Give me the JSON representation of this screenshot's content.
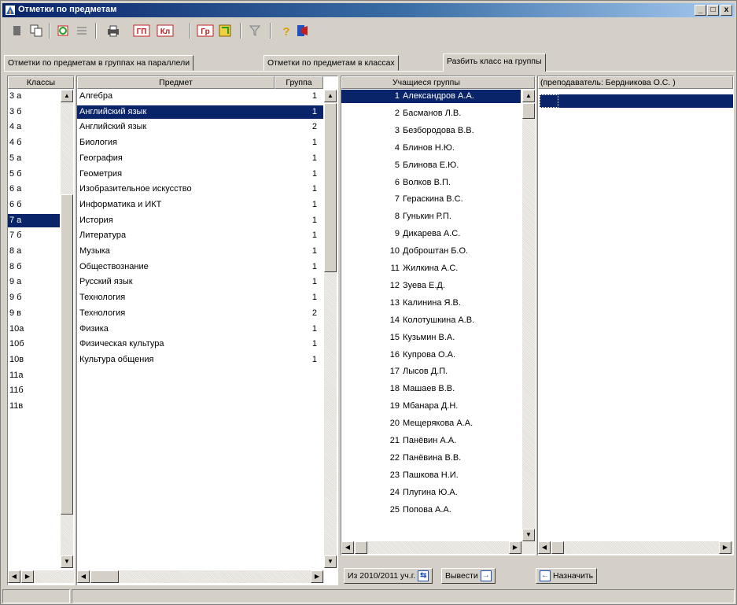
{
  "window": {
    "title": "Отметки по предметам",
    "controls": {
      "minimize": "_",
      "maximize": "□",
      "close": "x"
    }
  },
  "toolbar": {
    "icons": [
      "new-icon",
      "copy-icon",
      "refresh-icon",
      "list-icon",
      "print-icon",
      "gp-icon",
      "kl-icon",
      "gr-icon",
      "select-icon",
      "filter-icon",
      "help-icon",
      "exit-icon"
    ],
    "gp_label": "ГП",
    "kl_label": "Кл",
    "gr_label": "Гр"
  },
  "tabs": [
    {
      "label": "Отметки по предметам в группах на параллели",
      "active": false
    },
    {
      "label": "Отметки по предметам в классах",
      "active": false
    },
    {
      "label": "Разбить класс на группы",
      "active": true
    }
  ],
  "classes": {
    "header": "Классы",
    "items": [
      "3 а",
      "3 б",
      "4 а",
      "4 б",
      "5 а",
      "5 б",
      "6 а",
      "6 б",
      "7 а",
      "7 б",
      "8 а",
      "8 б",
      "9 а",
      "9 б",
      "9 в",
      "10а",
      "10б",
      "10в",
      "11а",
      "11б",
      "11в"
    ],
    "selected_index": 8
  },
  "subjects": {
    "header_subject": "Предмет",
    "header_group": "Группа",
    "rows": [
      {
        "subject": "Алгебра",
        "group": "1"
      },
      {
        "subject": "Английский язык",
        "group": "1"
      },
      {
        "subject": "Английский язык",
        "group": "2"
      },
      {
        "subject": "Биология",
        "group": "1"
      },
      {
        "subject": "География",
        "group": "1"
      },
      {
        "subject": "Геометрия",
        "group": "1"
      },
      {
        "subject": "Изобразительное искусство",
        "group": "1"
      },
      {
        "subject": "Информатика и ИКТ",
        "group": "1"
      },
      {
        "subject": "История",
        "group": "1"
      },
      {
        "subject": "Литература",
        "group": "1"
      },
      {
        "subject": "Музыка",
        "group": "1"
      },
      {
        "subject": "Обществознание",
        "group": "1"
      },
      {
        "subject": "Русский язык",
        "group": "1"
      },
      {
        "subject": "Технология",
        "group": "1"
      },
      {
        "subject": "Технология",
        "group": "2"
      },
      {
        "subject": "Физика",
        "group": "1"
      },
      {
        "subject": "Физическая культура",
        "group": "1"
      },
      {
        "subject": "Культура общения",
        "group": "1"
      }
    ],
    "selected_index": 1
  },
  "students": {
    "header": "Учащиеся группы",
    "teacher_header": "(преподаватель: Бердникова О.С. )",
    "rows": [
      {
        "n": "1",
        "name": "Александров А.А."
      },
      {
        "n": "2",
        "name": "Басманов Л.В."
      },
      {
        "n": "3",
        "name": "Безбородова В.В."
      },
      {
        "n": "4",
        "name": "Блинов Н.Ю."
      },
      {
        "n": "5",
        "name": "Блинова Е.Ю."
      },
      {
        "n": "6",
        "name": "Волков В.П."
      },
      {
        "n": "7",
        "name": "Гераскина В.С."
      },
      {
        "n": "8",
        "name": "Гунькин Р.П."
      },
      {
        "n": "9",
        "name": "Дикарева А.С."
      },
      {
        "n": "10",
        "name": "Доброштан Б.О."
      },
      {
        "n": "11",
        "name": "Жилкина А.С."
      },
      {
        "n": "12",
        "name": "Зуева Е.Д."
      },
      {
        "n": "13",
        "name": "Калинина Я.В."
      },
      {
        "n": "14",
        "name": "Колотушкина А.В."
      },
      {
        "n": "15",
        "name": "Кузьмин В.А."
      },
      {
        "n": "16",
        "name": "Купрова О.А."
      },
      {
        "n": "17",
        "name": "Лысов Д.П."
      },
      {
        "n": "18",
        "name": "Машаев В.В."
      },
      {
        "n": "19",
        "name": "Мбанара Д.Н."
      },
      {
        "n": "20",
        "name": "Мещерякова А.А."
      },
      {
        "n": "21",
        "name": "Панёвин А.А."
      },
      {
        "n": "22",
        "name": "Панёвина В.В."
      },
      {
        "n": "23",
        "name": "Пашкова Н.И."
      },
      {
        "n": "24",
        "name": "Плугина Ю.А."
      },
      {
        "n": "25",
        "name": "Попова А.А."
      }
    ],
    "selected_index": 0
  },
  "bottom_buttons": {
    "from_year": "Из 2010/2011 уч.г.",
    "output": "Вывести",
    "assign": "Назначить"
  },
  "colors": {
    "selection": "#0a246a",
    "title_start": "#0a246a",
    "title_end": "#a6caf0",
    "face": "#d4d0c8"
  }
}
